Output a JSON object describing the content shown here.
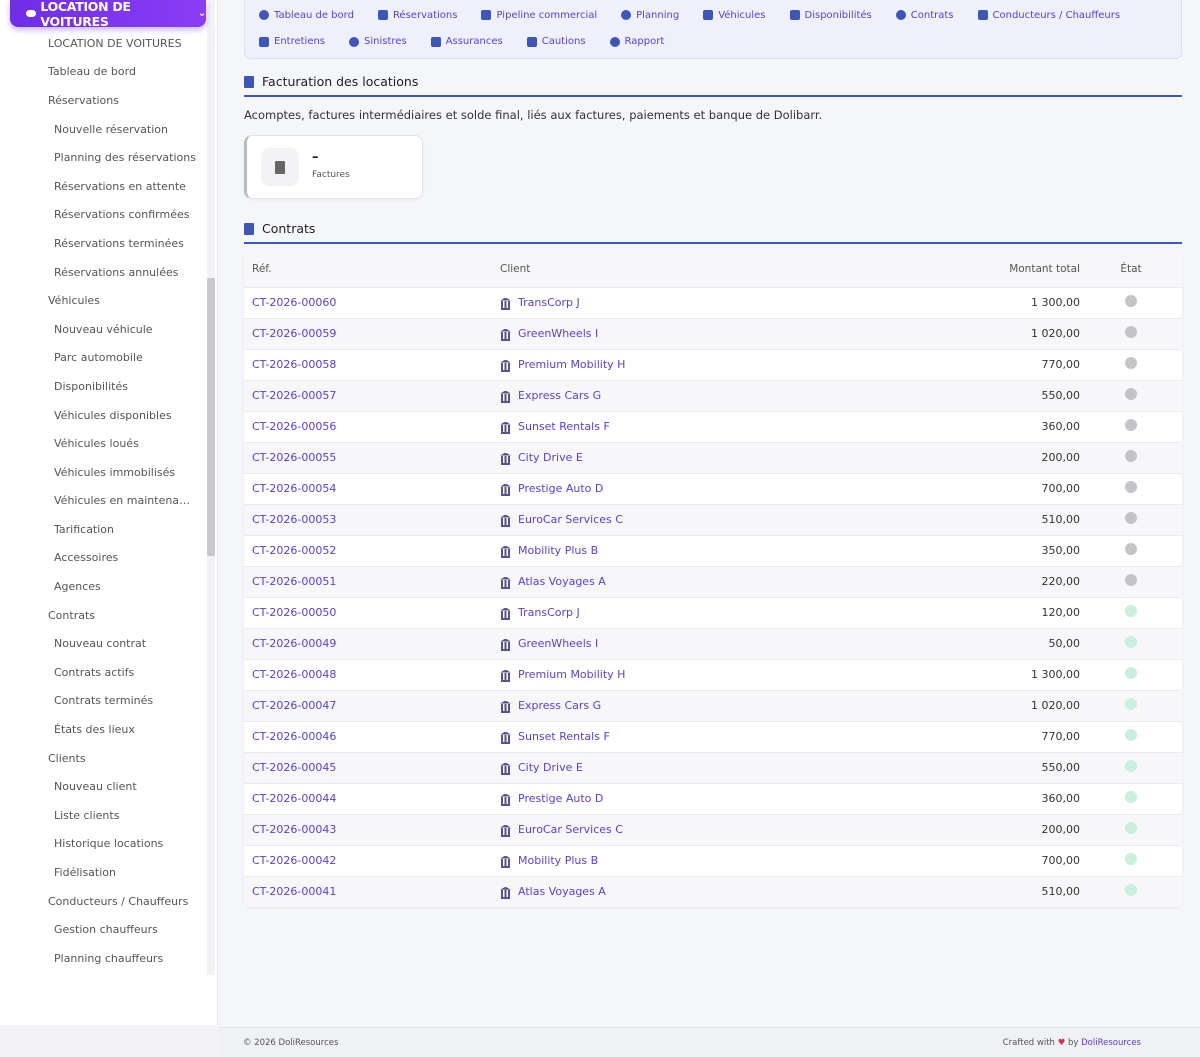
{
  "module_button": {
    "label": "LOCATION DE VOITURES"
  },
  "sidebar": {
    "items": [
      {
        "label": "LOCATION DE VOITURES",
        "level": 0
      },
      {
        "label": "Tableau de bord",
        "level": 0
      },
      {
        "label": "Réservations",
        "level": 0
      },
      {
        "label": "Nouvelle réservation",
        "level": 1
      },
      {
        "label": "Planning des réservations",
        "level": 1
      },
      {
        "label": "Réservations en attente",
        "level": 1
      },
      {
        "label": "Réservations confirmées",
        "level": 1
      },
      {
        "label": "Réservations terminées",
        "level": 1
      },
      {
        "label": "Réservations annulées",
        "level": 1
      },
      {
        "label": "Véhicules",
        "level": 0
      },
      {
        "label": "Nouveau véhicule",
        "level": 1
      },
      {
        "label": "Parc automobile",
        "level": 1
      },
      {
        "label": "Disponibilités",
        "level": 1
      },
      {
        "label": "Véhicules disponibles",
        "level": 1
      },
      {
        "label": "Véhicules loués",
        "level": 1
      },
      {
        "label": "Véhicules immobilisés",
        "level": 1
      },
      {
        "label": "Véhicules en maintenan…",
        "level": 1
      },
      {
        "label": "Tarification",
        "level": 1
      },
      {
        "label": "Accessoires",
        "level": 1
      },
      {
        "label": "Agences",
        "level": 1
      },
      {
        "label": "Contrats",
        "level": 0
      },
      {
        "label": "Nouveau contrat",
        "level": 1
      },
      {
        "label": "Contrats actifs",
        "level": 1
      },
      {
        "label": "Contrats terminés",
        "level": 1
      },
      {
        "label": "États des lieux",
        "level": 1
      },
      {
        "label": "Clients",
        "level": 0
      },
      {
        "label": "Nouveau client",
        "level": 1
      },
      {
        "label": "Liste clients",
        "level": 1
      },
      {
        "label": "Historique locations",
        "level": 1
      },
      {
        "label": "Fidélisation",
        "level": 1
      },
      {
        "label": "Conducteurs / Chauffeurs",
        "level": 0
      },
      {
        "label": "Gestion chauffeurs",
        "level": 1
      },
      {
        "label": "Planning chauffeurs",
        "level": 1
      }
    ]
  },
  "topnav": {
    "links": [
      {
        "label": "Tableau de bord",
        "icon": "dashboard-icon"
      },
      {
        "label": "Réservations",
        "icon": "calendar-check-icon"
      },
      {
        "label": "Pipeline commercial",
        "icon": "list-icon"
      },
      {
        "label": "Planning",
        "icon": "calendar-icon"
      },
      {
        "label": "Véhicules",
        "icon": "car-icon"
      },
      {
        "label": "Disponibilités",
        "icon": "grid-icon"
      },
      {
        "label": "Contrats",
        "icon": "file-signature-icon"
      },
      {
        "label": "Conducteurs / Chauffeurs",
        "icon": "id-card-icon"
      },
      {
        "label": "Entretiens",
        "icon": "wrench-icon"
      },
      {
        "label": "Sinistres",
        "icon": "car-crash-icon"
      },
      {
        "label": "Assurances",
        "icon": "shield-icon"
      },
      {
        "label": "Cautions",
        "icon": "money-icon"
      },
      {
        "label": "Rapport",
        "icon": "pie-chart-icon"
      }
    ]
  },
  "billing": {
    "title": "Facturation des locations",
    "description": "Acomptes, factures intermédiaires et solde final, liés aux factures, paiements et banque de Dolibarr.",
    "kpi": {
      "value": "–",
      "label": "Factures",
      "icon": "file-icon"
    }
  },
  "contracts": {
    "title": "Contrats",
    "columns": {
      "ref": "Réf.",
      "client": "Client",
      "amount": "Montant total",
      "state": "État"
    },
    "rows": [
      {
        "ref": "CT-2026-00060",
        "client": "TransCorp J",
        "amount": "1 300,00",
        "state_color": "#c4c4c8"
      },
      {
        "ref": "CT-2026-00059",
        "client": "GreenWheels I",
        "amount": "1 020,00",
        "state_color": "#c4c4c8"
      },
      {
        "ref": "CT-2026-00058",
        "client": "Premium Mobility H",
        "amount": "770,00",
        "state_color": "#c4c4c8"
      },
      {
        "ref": "CT-2026-00057",
        "client": "Express Cars G",
        "amount": "550,00",
        "state_color": "#c4c4c8"
      },
      {
        "ref": "CT-2026-00056",
        "client": "Sunset Rentals F",
        "amount": "360,00",
        "state_color": "#c4c4c8"
      },
      {
        "ref": "CT-2026-00055",
        "client": "City Drive E",
        "amount": "200,00",
        "state_color": "#c4c4c8"
      },
      {
        "ref": "CT-2026-00054",
        "client": "Prestige Auto D",
        "amount": "700,00",
        "state_color": "#c4c4c8"
      },
      {
        "ref": "CT-2026-00053",
        "client": "EuroCar Services C",
        "amount": "510,00",
        "state_color": "#c4c4c8"
      },
      {
        "ref": "CT-2026-00052",
        "client": "Mobility Plus B",
        "amount": "350,00",
        "state_color": "#c4c4c8"
      },
      {
        "ref": "CT-2026-00051",
        "client": "Atlas Voyages A",
        "amount": "220,00",
        "state_color": "#c4c4c8"
      },
      {
        "ref": "CT-2026-00050",
        "client": "TransCorp J",
        "amount": "120,00",
        "state_color": "#c9f0dc"
      },
      {
        "ref": "CT-2026-00049",
        "client": "GreenWheels I",
        "amount": "50,00",
        "state_color": "#c9f0dc"
      },
      {
        "ref": "CT-2026-00048",
        "client": "Premium Mobility H",
        "amount": "1 300,00",
        "state_color": "#c9f0dc"
      },
      {
        "ref": "CT-2026-00047",
        "client": "Express Cars G",
        "amount": "1 020,00",
        "state_color": "#c9f0dc"
      },
      {
        "ref": "CT-2026-00046",
        "client": "Sunset Rentals F",
        "amount": "770,00",
        "state_color": "#c9f0dc"
      },
      {
        "ref": "CT-2026-00045",
        "client": "City Drive E",
        "amount": "550,00",
        "state_color": "#c9f0dc"
      },
      {
        "ref": "CT-2026-00044",
        "client": "Prestige Auto D",
        "amount": "360,00",
        "state_color": "#c9f0dc"
      },
      {
        "ref": "CT-2026-00043",
        "client": "EuroCar Services C",
        "amount": "200,00",
        "state_color": "#c9f0dc"
      },
      {
        "ref": "CT-2026-00042",
        "client": "Mobility Plus B",
        "amount": "700,00",
        "state_color": "#c9f0dc"
      },
      {
        "ref": "CT-2026-00041",
        "client": "Atlas Voyages A",
        "amount": "510,00",
        "state_color": "#c9f0dc"
      }
    ]
  },
  "footer": {
    "copyright": "© 2026 DoliResources",
    "crafted": "Crafted with",
    "by": "by",
    "brand": "DoliResources"
  },
  "colors": {
    "accent": "#5b3fd6",
    "heading_line": "#3a57c7"
  }
}
